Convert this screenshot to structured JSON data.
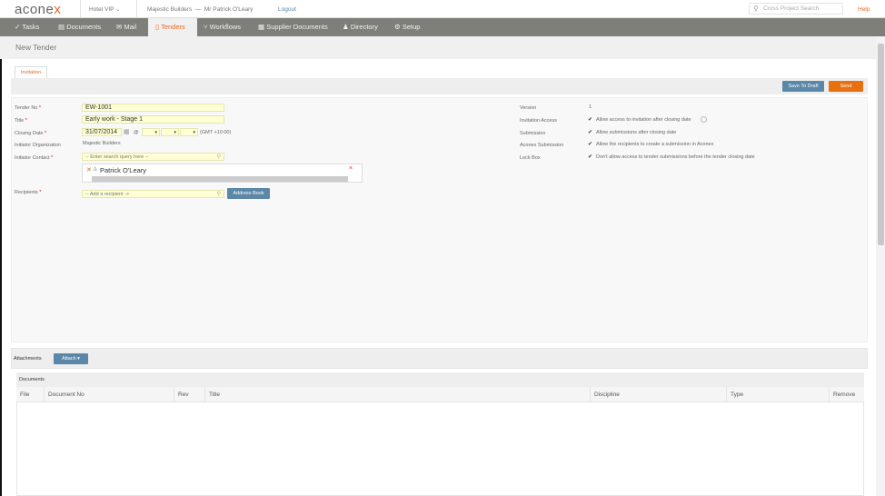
{
  "brand": {
    "logo_main": "acone",
    "logo_x": "x"
  },
  "topbar": {
    "project": "Hotel VIP",
    "org": "Majestic Builders",
    "dash": "—",
    "user": "Mr Patrick O'Leary",
    "logout": "Logout",
    "search_placeholder": "Cross Project Search",
    "help": "Help"
  },
  "nav": [
    {
      "icon": "✓",
      "label": "Tasks"
    },
    {
      "icon": "▤",
      "label": "Documents"
    },
    {
      "icon": "✉",
      "label": "Mail"
    },
    {
      "icon": "▯",
      "label": "Tenders"
    },
    {
      "icon": "⑂",
      "label": "Workflows"
    },
    {
      "icon": "▦",
      "label": "Supplier Documents"
    },
    {
      "icon": "♟",
      "label": "Directory"
    },
    {
      "icon": "⚙",
      "label": "Setup"
    }
  ],
  "page": {
    "title": "New Tender",
    "tab": "Invitation"
  },
  "toolbar": {
    "save_draft": "Save To Draft",
    "send": "Send"
  },
  "form": {
    "tender_no": {
      "label": "Tender No",
      "value": "EW-1001"
    },
    "title": {
      "label": "Title",
      "value": "Early work - Stage 1"
    },
    "closing_date": {
      "label": "Closing Date",
      "value": "31/07/2014",
      "at": "@",
      "timezone": "(GMT +10:00)"
    },
    "initiator_org": {
      "label": "Initiator Organization",
      "value": "Majestic Builders"
    },
    "initiator_contact": {
      "label": "Initiator Contact",
      "placeholder": "-- Enter search query here --",
      "selected": "Patrick O'Leary"
    },
    "recipients": {
      "label": "Recipients",
      "placeholder": "-- Add a recipient ->",
      "address_book": "Address Book"
    },
    "required_mark": "*"
  },
  "settings": {
    "version": {
      "label": "Version",
      "value": "1"
    },
    "invitation_access": {
      "label": "Invitation Access",
      "text": "Allow access to invitation after closing date",
      "checked": true
    },
    "submission": {
      "label": "Submission",
      "text": "Allow submissions after closing date",
      "checked": true
    },
    "aconex_submission": {
      "label": "Aconex Submission",
      "text": "Allow the recipients to create a submission in Aconex",
      "checked": true
    },
    "lock_box": {
      "label": "Lock Box",
      "text": "Don't allow access to tender submissions before the tender closing date",
      "checked": true
    }
  },
  "attachments": {
    "label": "Attachments",
    "attach": "Attach",
    "documents": "Documents",
    "columns": [
      "File",
      "Document No",
      "Rev",
      "Title",
      "Discipline",
      "Type",
      "Remove"
    ]
  },
  "colors": {
    "accent": "#e8671d",
    "nav_bg": "#7e7f78",
    "button_blue": "#5b87a8",
    "field_bg": "#ffffd6"
  }
}
